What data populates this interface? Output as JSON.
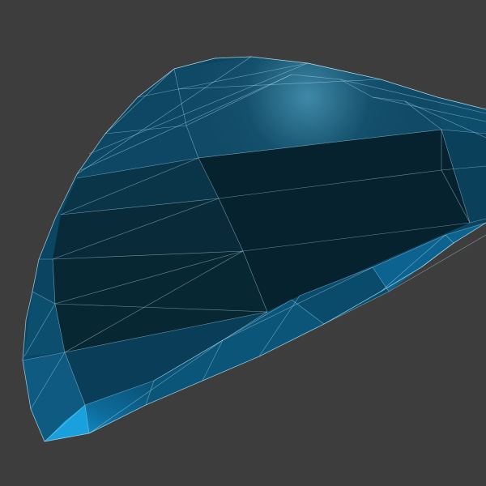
{
  "scene": {
    "background_color": "#3d3d3d",
    "object": "faceted-dome-mesh",
    "mesh_color": "#0b5f8a",
    "wire_color": "#bfe6f5",
    "highlight_color": "#1a9fd8",
    "shadow_color": "#052330"
  }
}
